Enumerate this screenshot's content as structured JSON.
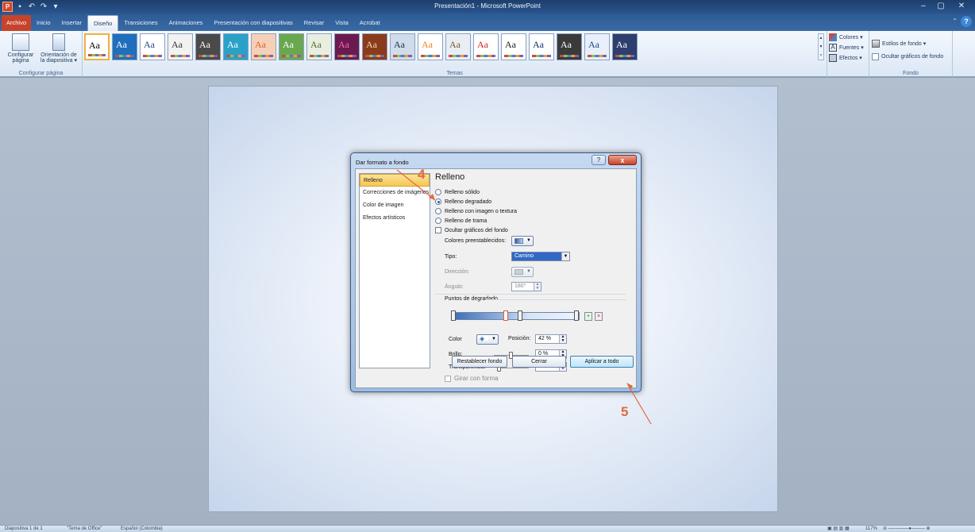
{
  "window": {
    "title": "Presentación1 - Microsoft PowerPoint",
    "app_logo": "P",
    "controls": [
      "–",
      "▢",
      "✕"
    ]
  },
  "tabs": [
    "Archivo",
    "Inicio",
    "Insertar",
    "Diseño",
    "Transiciones",
    "Animaciones",
    "Presentación con diapositivas",
    "Revisar",
    "Vista",
    "Acrobat"
  ],
  "active_tab": "Diseño",
  "ribbon": {
    "page_setup": {
      "btn1_line1": "Configurar",
      "btn1_line2": "página",
      "btn2_line1": "Orientación de",
      "btn2_line2": "la diapositiva ▾",
      "group_label": "Configurar página"
    },
    "themes": {
      "group_label": "Temas",
      "preview_text": "Aa",
      "count": 20,
      "swatches": [
        {
          "bg": "#ffffff",
          "fg": "#000000"
        },
        {
          "bg": "#1f6fbd",
          "fg": "#ffffff"
        },
        {
          "bg": "#ffffff",
          "fg": "#1f497d"
        },
        {
          "bg": "#f2f2f2",
          "fg": "#333333"
        },
        {
          "bg": "#4a4a4a",
          "fg": "#ffffff"
        },
        {
          "bg": "#2aa2c8",
          "fg": "#ffffff"
        },
        {
          "bg": "#f5d0b8",
          "fg": "#e0602a"
        },
        {
          "bg": "#6aa84f",
          "fg": "#ffffff"
        },
        {
          "bg": "#e8efe0",
          "fg": "#556b2f"
        },
        {
          "bg": "#6b1a4f",
          "fg": "#f06bb0"
        },
        {
          "bg": "#8a3b1c",
          "fg": "#f5d7b0"
        },
        {
          "bg": "#cfdcea",
          "fg": "#1f2f4f"
        },
        {
          "bg": "#ffffff",
          "fg": "#f0801e"
        },
        {
          "bg": "#e9eef5",
          "fg": "#7a5a2a"
        },
        {
          "bg": "#ffffff",
          "fg": "#d81e1e"
        },
        {
          "bg": "#ffffff",
          "fg": "#222222"
        },
        {
          "bg": "#ffffff",
          "fg": "#0d2e5c"
        },
        {
          "bg": "#3a3a3a",
          "fg": "#ffffff"
        },
        {
          "bg": "#e8f0fb",
          "fg": "#1f497d"
        },
        {
          "bg": "#2e3e6e",
          "fg": "#ffffff"
        }
      ]
    },
    "theme_options": {
      "colors": "Colores ▾",
      "fonts": "Fuentes ▾",
      "effects": "Efectos ▾"
    },
    "background": {
      "styles": "Estilos de fondo ▾",
      "hide": "Ocultar gráficos de fondo",
      "group_label": "Fondo"
    }
  },
  "dialog": {
    "title": "Dar formato a fondo",
    "help": "?",
    "close": "x",
    "nav": [
      "Relleno",
      "Correcciones de imágenes",
      "Color de imagen",
      "Efectos artísticos"
    ],
    "nav_selected": 0,
    "section_title": "Relleno",
    "fill_options": [
      "Relleno sólido",
      "Relleno degradado",
      "Relleno con imagen o textura",
      "Relleno de trama"
    ],
    "fill_selected": 1,
    "hide_graphics": "Ocultar gráficos del fondo",
    "presets_label": "Colores preestablecidos:",
    "type_label": "Tipo:",
    "type_value": "Camino",
    "direction_label": "Dirección:",
    "angle_label": "Ángulo:",
    "angle_value": "180°",
    "gradient_stops_label": "Puntos de degradado",
    "color_label": "Color",
    "position_label": "Posición:",
    "position_value": "42 %",
    "brightness_label": "Brillo:",
    "brightness_value": "0 %",
    "transparency_label": "Transparencia:",
    "transparency_value": "0 %",
    "rotate_label": "Girar con forma",
    "btn_reset": "Restablecer fondo",
    "btn_close": "Cerrar",
    "btn_apply_all": "Aplicar a todo",
    "selected_stop_position": 0.42
  },
  "annotations": {
    "step4": "4",
    "step5": "5",
    "color": "#e06a3f"
  },
  "statusbar": {
    "slide": "Diapositiva 1 de 1",
    "theme": "\"Tema de Office\"",
    "language": "Español (Colombia)",
    "zoom": "117%"
  }
}
